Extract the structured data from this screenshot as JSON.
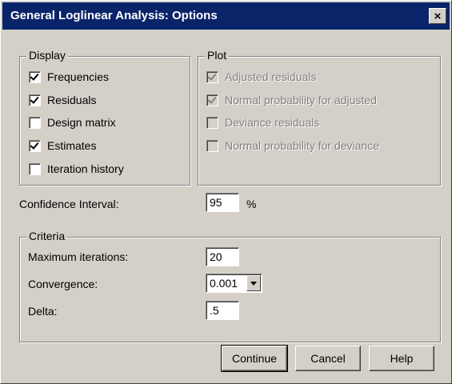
{
  "window": {
    "title": "General Loglinear Analysis: Options",
    "close_glyph": "×"
  },
  "display": {
    "legend": "Display",
    "items": [
      {
        "label": "Frequencies",
        "checked": true
      },
      {
        "label": "Residuals",
        "checked": true
      },
      {
        "label": "Design matrix",
        "checked": false
      },
      {
        "label": "Estimates",
        "checked": true
      },
      {
        "label": "Iteration history",
        "checked": false
      }
    ]
  },
  "plot": {
    "legend": "Plot",
    "items": [
      {
        "label": "Adjusted residuals",
        "checked": true,
        "enabled": false
      },
      {
        "label": "Normal probability for adjusted",
        "checked": true,
        "enabled": false
      },
      {
        "label": "Deviance residuals",
        "checked": false,
        "enabled": false
      },
      {
        "label": "Normal probability for deviance",
        "checked": false,
        "enabled": false
      }
    ]
  },
  "confidence": {
    "label": "Confidence Interval:",
    "value": "95",
    "unit": "%"
  },
  "criteria": {
    "legend": "Criteria",
    "max_iterations_label": "Maximum iterations:",
    "max_iterations_value": "20",
    "convergence_label": "Convergence:",
    "convergence_value": "0.001",
    "delta_label": "Delta:",
    "delta_value": ".5"
  },
  "buttons": {
    "continue": "Continue",
    "cancel": "Cancel",
    "help": "Help"
  }
}
